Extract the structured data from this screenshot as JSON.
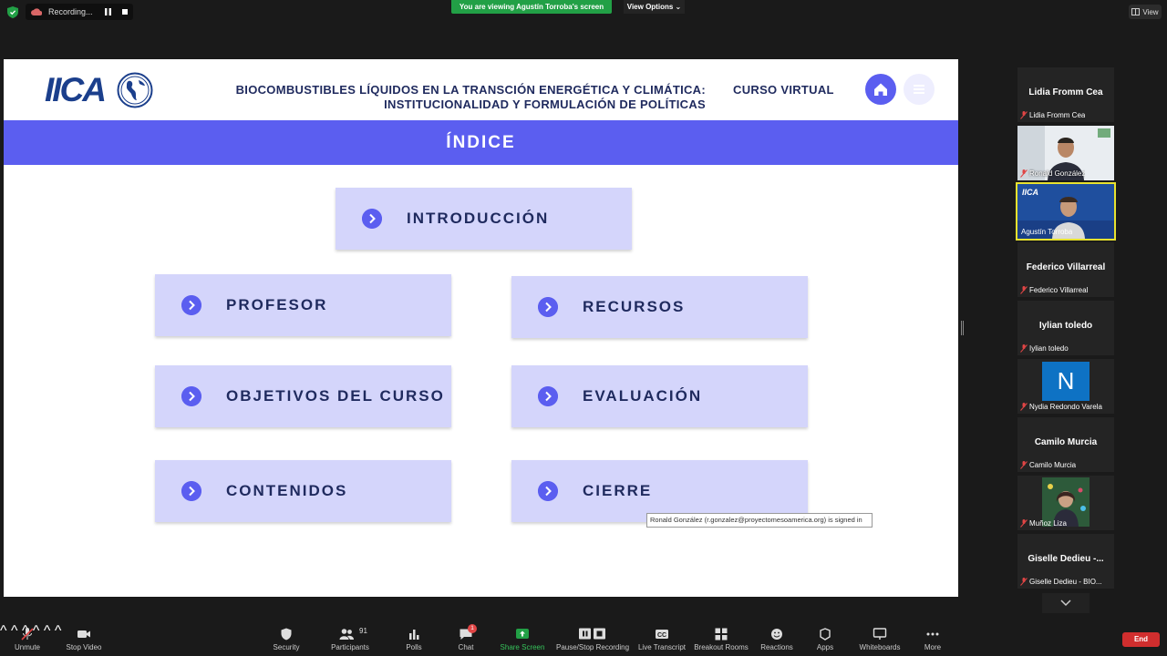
{
  "top_bar": {
    "recording_label": "Recording...",
    "viewing_banner": "You are viewing Agustín Torroba's screen",
    "view_options": "View Options",
    "view_label": "View"
  },
  "slide": {
    "logo_text": "IICA",
    "title_line1": "BIOCOMBUSTIBLES LÍQUIDOS EN LA TRANSCIÓN ENERGÉTICA Y CLIMÁTICA:",
    "title_line2": "INSTITUCIONALIDAD Y FORMULACIÓN DE POLÍTICAS",
    "course_type": "CURSO VIRTUAL",
    "banner": "ÍNDICE",
    "items": [
      "INTRODUCCIÓN",
      "PROFESOR",
      "RECURSOS",
      "OBJETIVOS DEL CURSO",
      "EVALUACIÓN",
      "CONTENIDOS",
      "CIERRE"
    ],
    "accent_color": "#5b5ef0",
    "card_color": "#d4d5fb"
  },
  "tooltip": "Ronald González (r.gonzalez@proyectomesoamerica.org) is signed in",
  "participants": [
    {
      "display": "Lidia Fromm Cea",
      "tag": "Lidia Fromm Cea"
    },
    {
      "display": "",
      "tag": "Ronald González"
    },
    {
      "display": "",
      "tag": "Agustín Torroba"
    },
    {
      "display": "Federico Villarreal",
      "tag": "Federico Villarreal"
    },
    {
      "display": "Iylian toledo",
      "tag": "Iylian toledo"
    },
    {
      "display": "N",
      "tag": "Nydia Redondo Varela"
    },
    {
      "display": "Camilo Murcia",
      "tag": "Camilo Murcia"
    },
    {
      "display": "",
      "tag": "Muñoz Liza"
    },
    {
      "display": "Giselle Dedieu -...",
      "tag": "Giselle Dedieu - BIO..."
    }
  ],
  "toolbar": {
    "unmute": "Unmute",
    "stop_video": "Stop Video",
    "security": "Security",
    "participants": "Participants",
    "participants_count": "91",
    "polls": "Polls",
    "chat": "Chat",
    "chat_badge": "1",
    "share_screen": "Share Screen",
    "pause_recording": "Pause/Stop Recording",
    "live_transcript": "Live Transcript",
    "breakout_rooms": "Breakout Rooms",
    "reactions": "Reactions",
    "apps": "Apps",
    "whiteboards": "Whiteboards",
    "more": "More",
    "end": "End"
  }
}
